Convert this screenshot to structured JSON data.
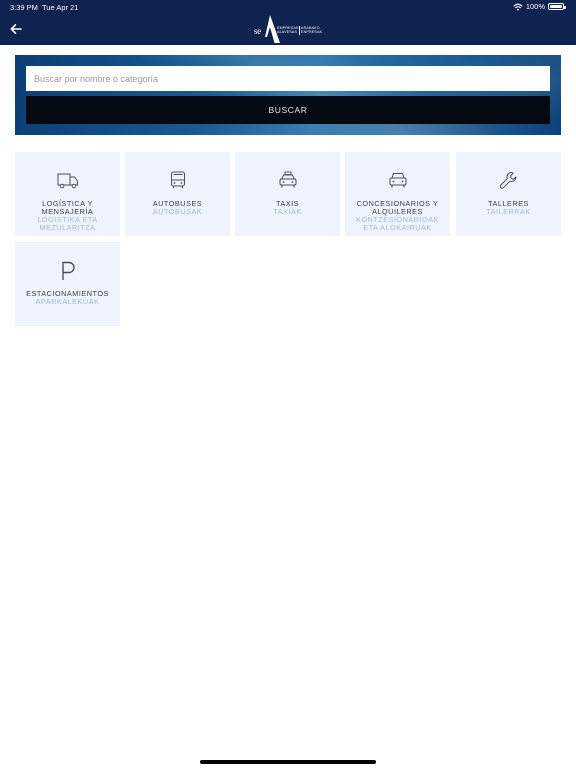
{
  "status_bar": {
    "time": "3:39 PM",
    "date": "Tue Apr 21",
    "battery": "100%"
  },
  "header": {
    "back_icon": "arrow-left-icon",
    "logo": {
      "mark": "se",
      "line1_left": "EMPRESAS",
      "line2_left": "ALAVESAS",
      "line1_right": "ARABAKO",
      "line2_right": "ENPRESAK"
    }
  },
  "search": {
    "placeholder": "Buscar por nombre o categoría",
    "value": "",
    "button_label": "BUSCAR"
  },
  "categories": [
    {
      "title": "LOGÍSTICA Y MENSAJERÍA",
      "subtitle": "LOGISTIKA ETA MEZULARITZA",
      "icon": "truck-icon"
    },
    {
      "title": "AUTOBUSES",
      "subtitle": "AUTOBUSAK",
      "icon": "bus-icon"
    },
    {
      "title": "TAXIS",
      "subtitle": "TAXIAK",
      "icon": "taxi-icon"
    },
    {
      "title": "CONCESIONARIOS Y ALQUILERES",
      "subtitle": "KONTZESIONARIOAK ETA ALOKAIRUAK",
      "icon": "car-icon"
    },
    {
      "title": "TALLERES",
      "subtitle": "TAILERRAK",
      "icon": "wrench-icon"
    },
    {
      "title": "ESTACIONAMIENTOS",
      "subtitle": "APARKALEKUAK",
      "icon": "parking-icon"
    }
  ],
  "colors": {
    "header_bg": "#0f2350",
    "tile_bg": "#eef3fd",
    "tile_title": "#3a3f4b",
    "tile_subtitle": "#9fb9da",
    "button_bg": "#050a12"
  }
}
